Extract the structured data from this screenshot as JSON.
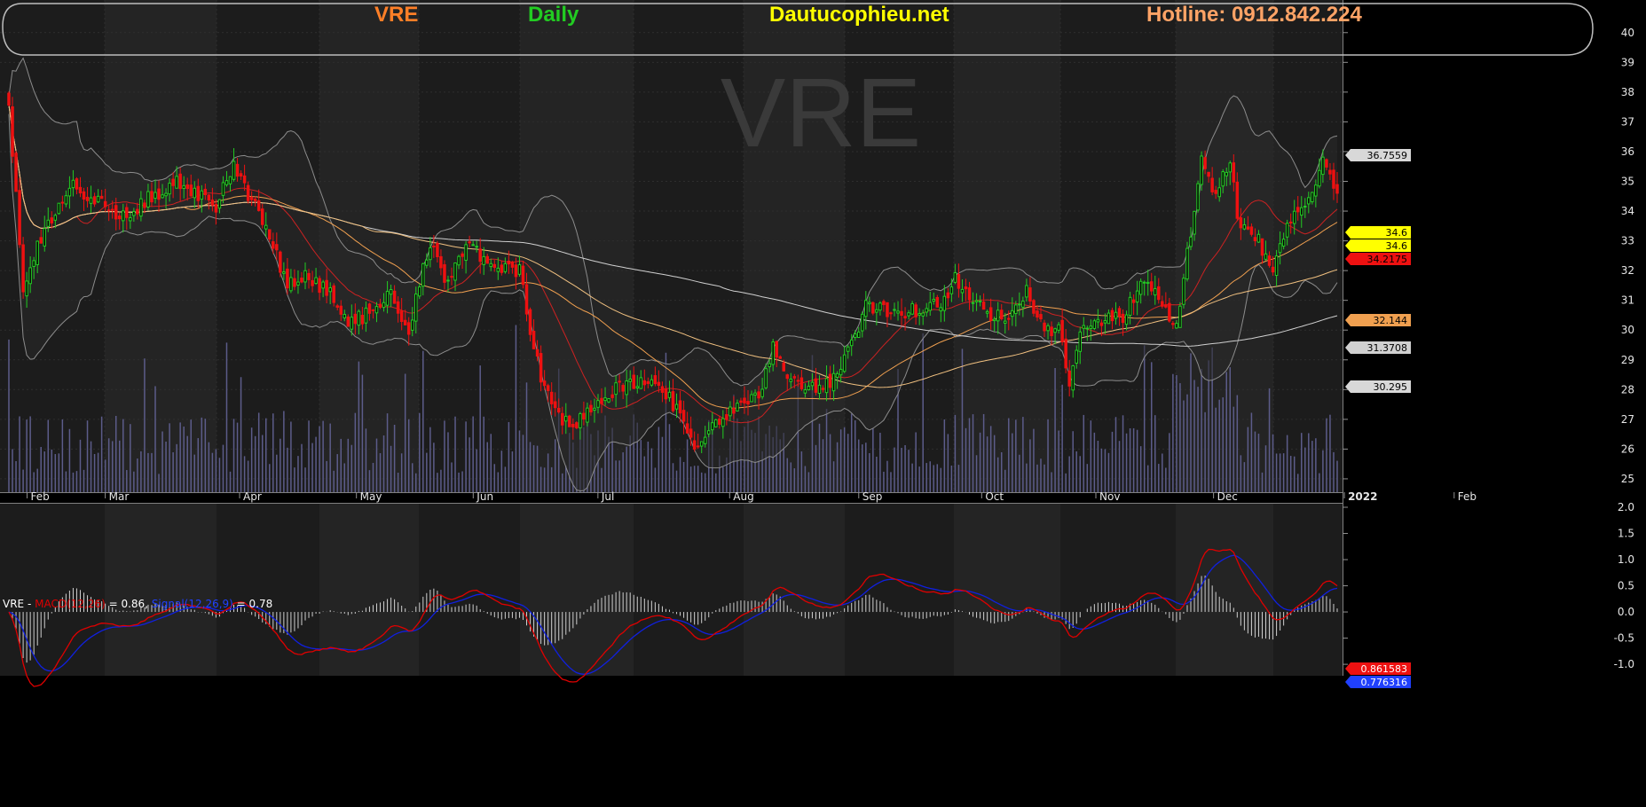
{
  "header": {
    "ticker": "VRE",
    "interval": "Daily",
    "site": "Dautucophieu.net",
    "hotline": "Hotline: 0912.842.224"
  },
  "watermark": "VRE",
  "colors": {
    "background": "#000000",
    "up_candle": "#22cc22",
    "down_candle": "#ee1111",
    "header_ticker": "#ff7f27",
    "header_interval": "#22cc22",
    "header_site": "#ffff00",
    "header_hotline": "#ffa366",
    "macd_line": "#e00000",
    "signal_line": "#1020e0",
    "volume": "#5c5c8a"
  },
  "macd_legend": {
    "ticker": "VRE - ",
    "macd_name": "MACD(12,26)",
    "macd_value": " = 0.86, ",
    "signal_name": "Signal(12,26,9)",
    "signal_value": " = 0.78"
  },
  "chart_data": [
    {
      "type": "candlestick",
      "title": "VRE Daily",
      "x": [
        "Feb",
        "Mar",
        "Apr",
        "May",
        "Jun",
        "Jul",
        "Aug",
        "Sep",
        "Oct",
        "Nov",
        "Dec",
        "2022",
        "Feb"
      ],
      "ylim": [
        24.7,
        40.5
      ],
      "y_ticks": [
        25,
        26,
        27,
        28,
        29,
        30,
        31,
        32,
        33,
        34,
        35,
        36,
        37,
        38,
        39,
        40
      ],
      "grid": true,
      "close_anchors": [
        [
          0,
          37.5
        ],
        [
          4,
          31.5
        ],
        [
          10,
          33.5
        ],
        [
          18,
          34.8
        ],
        [
          25,
          34.3
        ],
        [
          32,
          33.8
        ],
        [
          40,
          34.5
        ],
        [
          48,
          35.0
        ],
        [
          54,
          34.5
        ],
        [
          58,
          34.2
        ],
        [
          63,
          35.5
        ],
        [
          67,
          34.5
        ],
        [
          72,
          33.5
        ],
        [
          78,
          31.5
        ],
        [
          84,
          31.8
        ],
        [
          90,
          31.2
        ],
        [
          95,
          30.3
        ],
        [
          100,
          30.5
        ],
        [
          107,
          31.3
        ],
        [
          112,
          30.0
        ],
        [
          118,
          33.0
        ],
        [
          122,
          31.5
        ],
        [
          128,
          32.8
        ],
        [
          132,
          32.5
        ],
        [
          138,
          32.0
        ],
        [
          143,
          32.0
        ],
        [
          146,
          30.0
        ],
        [
          150,
          28.0
        ],
        [
          154,
          27.0
        ],
        [
          158,
          26.8
        ],
        [
          165,
          27.5
        ],
        [
          170,
          28.0
        ],
        [
          177,
          28.3
        ],
        [
          183,
          28.0
        ],
        [
          188,
          27.2
        ],
        [
          193,
          26.0
        ],
        [
          198,
          27.0
        ],
        [
          205,
          27.5
        ],
        [
          210,
          27.7
        ],
        [
          214,
          29.5
        ],
        [
          218,
          28.3
        ],
        [
          225,
          28.0
        ],
        [
          230,
          28.3
        ],
        [
          236,
          29.5
        ],
        [
          240,
          30.8
        ],
        [
          248,
          30.6
        ],
        [
          256,
          30.7
        ],
        [
          262,
          31.0
        ],
        [
          265,
          31.8
        ],
        [
          270,
          31.0
        ],
        [
          275,
          30.5
        ],
        [
          280,
          30.3
        ],
        [
          285,
          31.3
        ],
        [
          290,
          30.0
        ],
        [
          294,
          30.1
        ],
        [
          297,
          28.0
        ],
        [
          301,
          30.3
        ],
        [
          306,
          30.3
        ],
        [
          312,
          30.5
        ],
        [
          318,
          31.8
        ],
        [
          324,
          30.6
        ],
        [
          327,
          30.3
        ],
        [
          330,
          32.5
        ],
        [
          334,
          35.8
        ],
        [
          338,
          34.5
        ],
        [
          342,
          35.7
        ],
        [
          344,
          33.8
        ],
        [
          350,
          33.0
        ],
        [
          354,
          32.0
        ],
        [
          356,
          33.0
        ],
        [
          360,
          34.0
        ],
        [
          365,
          34.5
        ],
        [
          368,
          35.8
        ],
        [
          372,
          34.6
        ]
      ],
      "last_close": 34.6,
      "moving_averages": [
        {
          "color": "#cc2222",
          "last": 34.2175
        },
        {
          "color": "#f0a050",
          "last": 32.144
        },
        {
          "color": "#d0d0d0",
          "last": 31.3708
        },
        {
          "color": "#f0c080",
          "last": 30.295
        }
      ],
      "bollinger_upper_last": 36.7559,
      "price_tags": [
        "36.7559",
        "34.6",
        "34.6",
        "34.2175",
        "32.144",
        "31.3708",
        "30.295"
      ]
    },
    {
      "type": "line",
      "title": "MACD",
      "ylim": [
        -1.1,
        2.0
      ],
      "y_ticks": [
        "2.0",
        "1.5",
        "1.0",
        "0.5",
        "0.0",
        "-0.5",
        "-1.0"
      ],
      "series": [
        {
          "name": "MACD(12,26)",
          "last": 0.86,
          "tag": "0.861583"
        },
        {
          "name": "Signal(12,26,9)",
          "last": 0.78,
          "tag": "0.776316"
        }
      ]
    }
  ]
}
